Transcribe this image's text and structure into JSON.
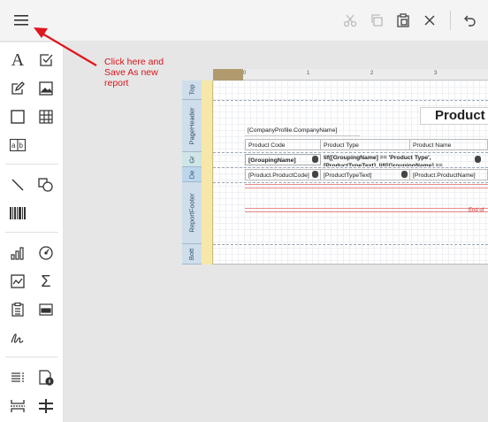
{
  "toolbar": {
    "menu_icon": "hamburger-menu-icon",
    "actions": [
      "cut-icon",
      "copy-icon",
      "paste-icon",
      "delete-icon",
      "undo-icon"
    ]
  },
  "sidebar": {
    "tools": [
      "label-icon",
      "checkbox-icon",
      "rich-text-icon",
      "picture-icon",
      "panel-icon",
      "table-icon",
      "character-comb-icon",
      "line-icon",
      "shape-icon",
      "barcode-icon",
      "chart-icon",
      "gauge-icon",
      "sparkline-icon",
      "summary-icon",
      "table-of-contents-icon",
      "page-info-icon",
      "signature-icon",
      "subreport-icon",
      "pdf-content-icon",
      "page-break-icon",
      "cross-band-icon"
    ]
  },
  "annotation": {
    "text": "Click here and Save As new report",
    "color": "#d8161d"
  },
  "ruler": {
    "ticks": [
      "0",
      "1",
      "2",
      "3"
    ]
  },
  "bands": [
    "TopMargin",
    "PageHeader",
    "GroupHeader",
    "Detail",
    "ReportFooter",
    "BottomMargin"
  ],
  "band_labels": [
    "Top",
    "PageHeader",
    "Gr",
    "De",
    "ReportFooter",
    "Bott"
  ],
  "report": {
    "title": "Product",
    "company_field": "[CompanyProfile.CompanyName]",
    "headers": [
      "Product Code",
      "Product Type",
      "Product Name"
    ],
    "group_field": "[GroupingName]",
    "group_expr": "Iif([GroupingName] == 'Product Type',",
    "group_expr2": "[ProductTypeText], Iif([GroupingName] ==",
    "detail": [
      "[Product.ProductCode]",
      "[ProductTypeText]",
      "[Product.ProductName]"
    ],
    "footer_text": "End of"
  }
}
